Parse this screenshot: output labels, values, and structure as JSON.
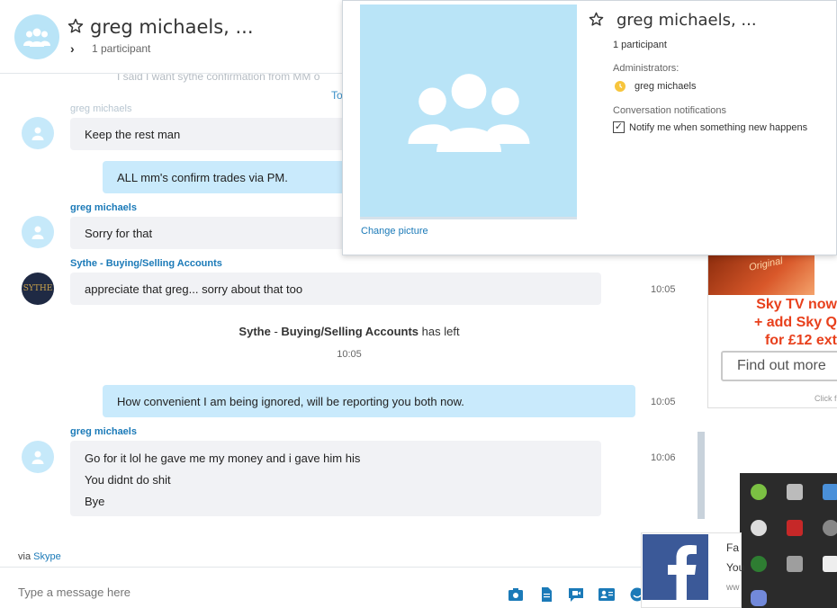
{
  "header": {
    "title": "greg michaels, ...",
    "participants": "1 participant"
  },
  "chat": {
    "faded_top": "I said I want sythe confirmation from MM o",
    "faded_top2": "To",
    "faded_sender": "greg michaels",
    "messages": [
      {
        "text": "Keep the rest man"
      },
      {
        "text": "ALL mm's confirm trades via PM."
      },
      {
        "sender": "greg michaels",
        "text": "Sorry for that"
      },
      {
        "sender": "Sythe - Buying/Selling Accounts",
        "text": "appreciate that greg... sorry about that too",
        "time": "10:05"
      },
      {
        "text": "How convenient I am being ignored, will be reporting you both now.",
        "time": "10:05"
      },
      {
        "sender": "greg michaels",
        "lines": [
          "Go for it lol he gave me my money and i gave him his",
          "You didnt do shit",
          "Bye"
        ],
        "time": "10:06"
      }
    ],
    "system": {
      "name_a": "Sythe",
      "dash": " - ",
      "name_b": "Buying/Selling Accounts",
      "action": " has left",
      "time": "10:05"
    },
    "sythe_avatar": "SYTHE"
  },
  "via": {
    "prefix": "via ",
    "link": "Skype"
  },
  "composer": {
    "placeholder": "Type a message here"
  },
  "popup": {
    "title": "greg michaels, ...",
    "participants": "1 participant",
    "change_picture": "Change picture",
    "admins_label": "Administrators:",
    "admin_name": "greg michaels",
    "notifications_label": "Conversation notifications",
    "notify_label": "Notify me when something new happens",
    "notify_checked": true
  },
  "ad": {
    "badge": "Original",
    "line1": "Sky TV now",
    "line2": "+ add Sky Q",
    "line3": "for £12 ext",
    "button": "Find out more",
    "click": "Click f",
    "accent": "#e8401c"
  },
  "fb_toast": {
    "title": "Fa",
    "sub": "You",
    "url": "ww"
  },
  "colors": {
    "skype_blue": "#1b7ab8",
    "outgoing_bubble": "#c9eafc",
    "incoming_bubble": "#f1f2f5",
    "avatar_bg": "#b9e4f7"
  },
  "icons": [
    "group-icon",
    "star-icon",
    "chevron-right-icon",
    "person-icon",
    "send-media-icon",
    "send-file-icon",
    "video-message-icon",
    "send-contact-icon",
    "emoticon-icon",
    "facebook-icon"
  ]
}
